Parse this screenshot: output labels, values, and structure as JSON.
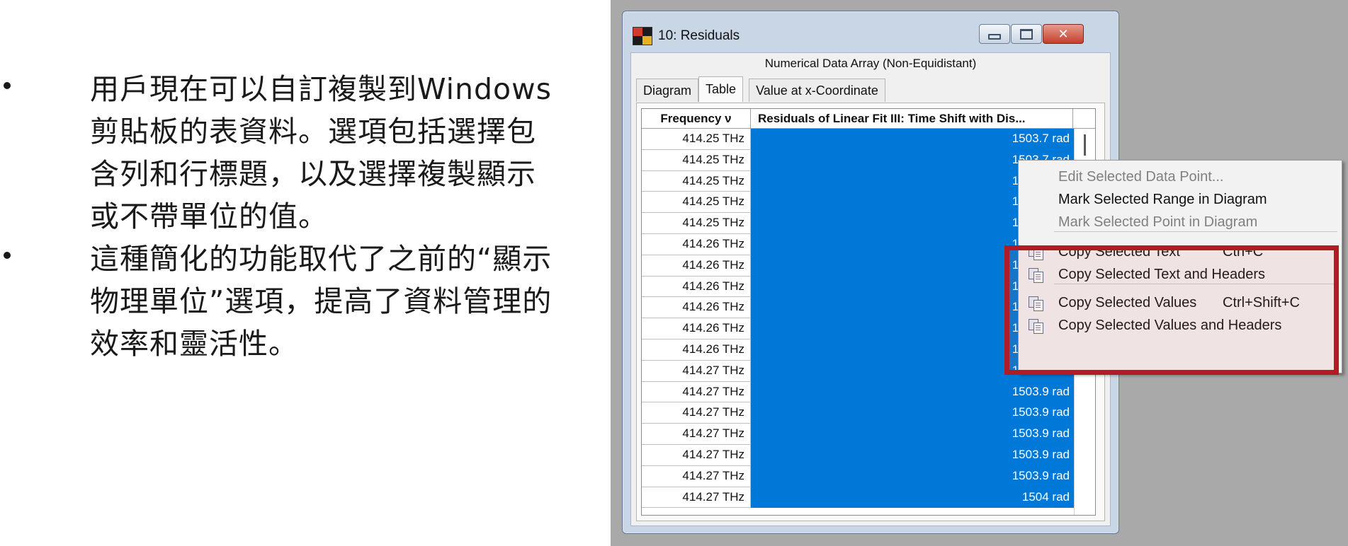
{
  "slide": {
    "bullets": [
      "用戶現在可以自訂複製到Windows 剪貼板的表資料。選項包括選擇包含列和行標題，以及選擇複製顯示或不帶單位的值。",
      "這種簡化的功能取代了之前的“顯示物理單位”選項，提高了資料管理的效率和靈活性。"
    ]
  },
  "window": {
    "title": "10: Residuals",
    "subtitle": "Numerical Data Array (Non-Equidistant)",
    "close_glyph": "✕",
    "tabs": [
      "Diagram",
      "Table",
      "Value at x-Coordinate"
    ],
    "active_tab": "Table"
  },
  "table": {
    "headers": [
      "Frequency ν",
      "Residuals of Linear Fit III: Time Shift with Dis..."
    ],
    "rows": [
      [
        "414.25 THz",
        "1503.7 rad"
      ],
      [
        "414.25 THz",
        "1503.7 rad"
      ],
      [
        "414.25 THz",
        "1503.7 rad"
      ],
      [
        "414.25 THz",
        "1503.7 rad"
      ],
      [
        "414.25 THz",
        "1503.8 rad"
      ],
      [
        "414.26 THz",
        "1503.8 rad"
      ],
      [
        "414.26 THz",
        "1503.8 rad"
      ],
      [
        "414.26 THz",
        "1503.8 rad"
      ],
      [
        "414.26 THz",
        "1503.8 rad"
      ],
      [
        "414.26 THz",
        "1503.8 rad"
      ],
      [
        "414.26 THz",
        "1503.8 rad"
      ],
      [
        "414.27 THz",
        "1503.9 rad"
      ],
      [
        "414.27 THz",
        "1503.9 rad"
      ],
      [
        "414.27 THz",
        "1503.9 rad"
      ],
      [
        "414.27 THz",
        "1503.9 rad"
      ],
      [
        "414.27 THz",
        "1503.9 rad"
      ],
      [
        "414.27 THz",
        "1503.9 rad"
      ],
      [
        "414.27 THz",
        "1504 rad"
      ]
    ],
    "selection_color": "#0078d7"
  },
  "context_menu": {
    "items": [
      {
        "label": "Edit Selected Data Point...",
        "shortcut": "",
        "enabled": false,
        "icon": ""
      },
      {
        "label": "Mark Selected Range in Diagram",
        "shortcut": "",
        "enabled": true,
        "icon": ""
      },
      {
        "label": "Mark Selected Point in Diagram",
        "shortcut": "",
        "enabled": false,
        "icon": ""
      },
      {
        "label": "Copy Selected Text",
        "shortcut": "Ctrl+C",
        "enabled": true,
        "icon": "copy-icon"
      },
      {
        "label": "Copy Selected Text and Headers",
        "shortcut": "",
        "enabled": true,
        "icon": "copy-icon"
      },
      {
        "label": "Copy Selected Values",
        "shortcut": "Ctrl+Shift+C",
        "enabled": true,
        "icon": "copy-icon"
      },
      {
        "label": "Copy Selected Values and Headers",
        "shortcut": "",
        "enabled": true,
        "icon": "copy-icon"
      }
    ],
    "highlight_color": "#b01c26"
  }
}
